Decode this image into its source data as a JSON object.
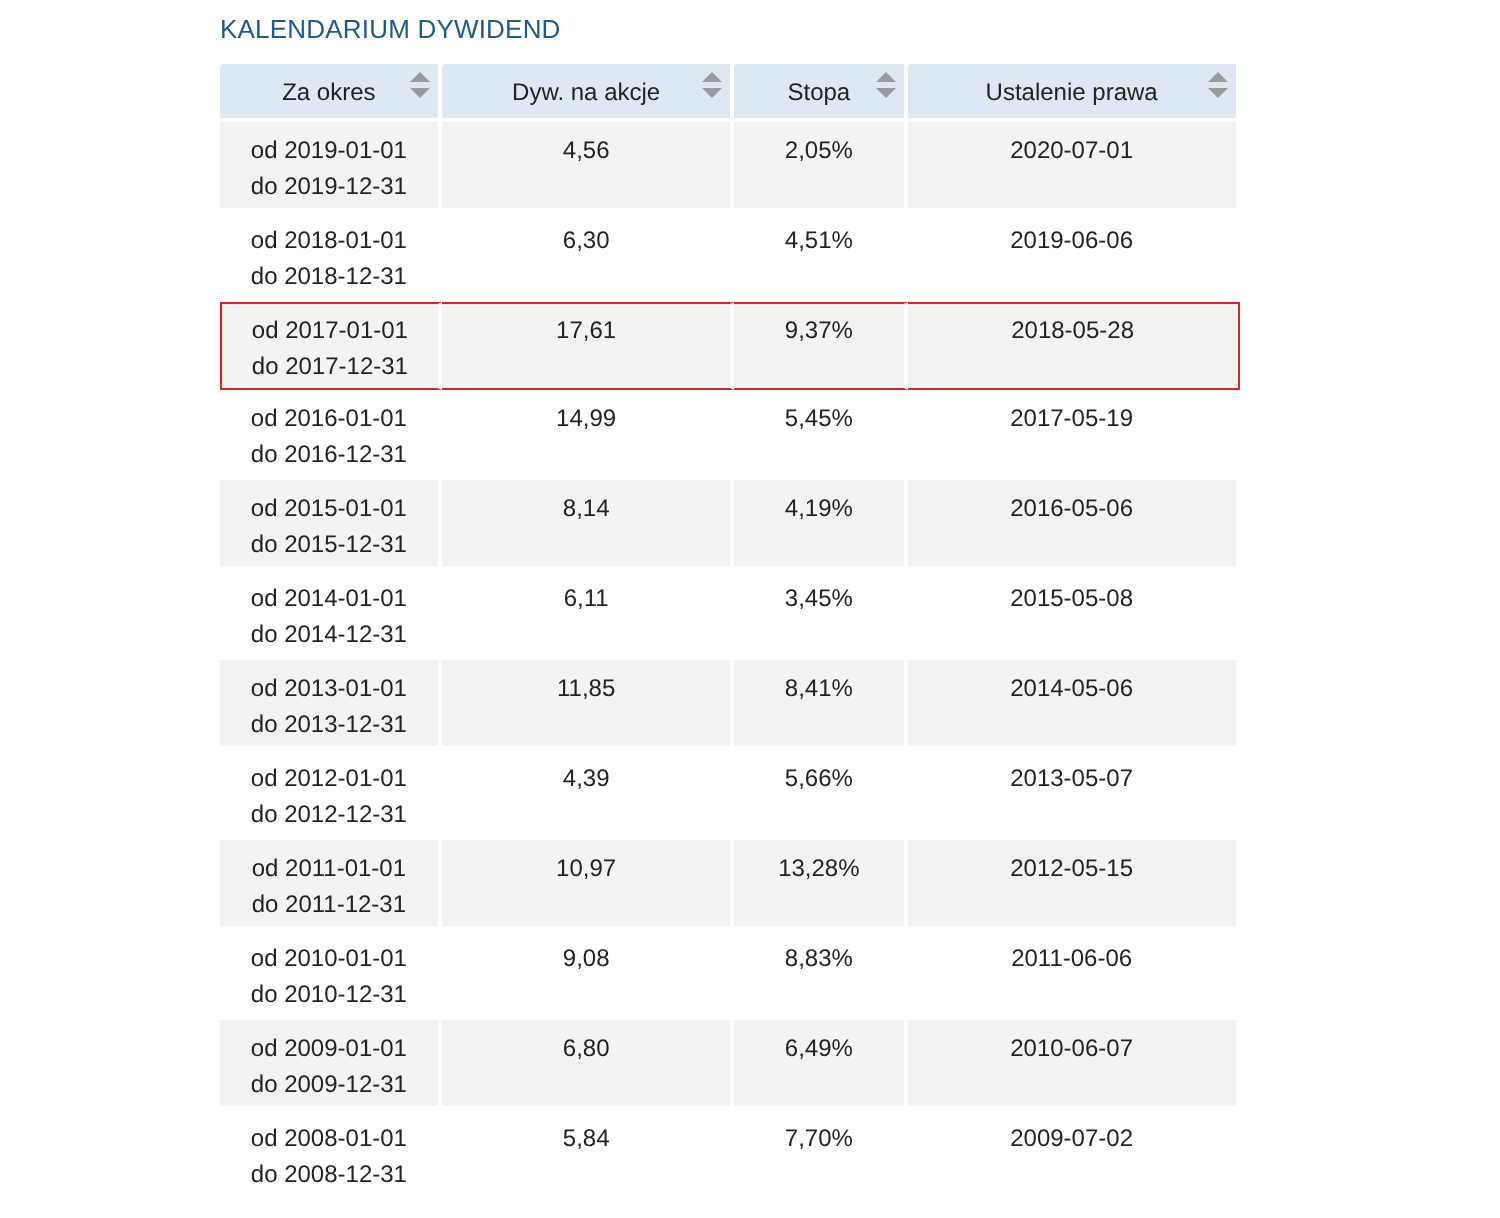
{
  "title": "KALENDARIUM DYWIDEND",
  "table": {
    "columns": [
      "Za okres",
      "Dyw. na akcje",
      "Stopa",
      "Ustalenie prawa"
    ],
    "rows": [
      {
        "period_from": "od 2019-01-01",
        "period_to": "do 2019-12-31",
        "dividend": "4,56",
        "rate": "2,05%",
        "record_date": "2020-07-01",
        "highlighted": false
      },
      {
        "period_from": "od 2018-01-01",
        "period_to": "do 2018-12-31",
        "dividend": "6,30",
        "rate": "4,51%",
        "record_date": "2019-06-06",
        "highlighted": false
      },
      {
        "period_from": "od 2017-01-01",
        "period_to": "do 2017-12-31",
        "dividend": "17,61",
        "rate": "9,37%",
        "record_date": "2018-05-28",
        "highlighted": true
      },
      {
        "period_from": "od 2016-01-01",
        "period_to": "do 2016-12-31",
        "dividend": "14,99",
        "rate": "5,45%",
        "record_date": "2017-05-19",
        "highlighted": false
      },
      {
        "period_from": "od 2015-01-01",
        "period_to": "do 2015-12-31",
        "dividend": "8,14",
        "rate": "4,19%",
        "record_date": "2016-05-06",
        "highlighted": false
      },
      {
        "period_from": "od 2014-01-01",
        "period_to": "do 2014-12-31",
        "dividend": "6,11",
        "rate": "3,45%",
        "record_date": "2015-05-08",
        "highlighted": false
      },
      {
        "period_from": "od 2013-01-01",
        "period_to": "do 2013-12-31",
        "dividend": "11,85",
        "rate": "8,41%",
        "record_date": "2014-05-06",
        "highlighted": false
      },
      {
        "period_from": "od 2012-01-01",
        "period_to": "do 2012-12-31",
        "dividend": "4,39",
        "rate": "5,66%",
        "record_date": "2013-05-07",
        "highlighted": false
      },
      {
        "period_from": "od 2011-01-01",
        "period_to": "do 2011-12-31",
        "dividend": "10,97",
        "rate": "13,28%",
        "record_date": "2012-05-15",
        "highlighted": false
      },
      {
        "period_from": "od 2010-01-01",
        "period_to": "do 2010-12-31",
        "dividend": "9,08",
        "rate": "8,83%",
        "record_date": "2011-06-06",
        "highlighted": false
      },
      {
        "period_from": "od 2009-01-01",
        "period_to": "do 2009-12-31",
        "dividend": "6,80",
        "rate": "6,49%",
        "record_date": "2010-06-07",
        "highlighted": false
      },
      {
        "period_from": "od 2008-01-01",
        "period_to": "do 2008-12-31",
        "dividend": "5,84",
        "rate": "7,70%",
        "record_date": "2009-07-02",
        "highlighted": false
      }
    ]
  }
}
